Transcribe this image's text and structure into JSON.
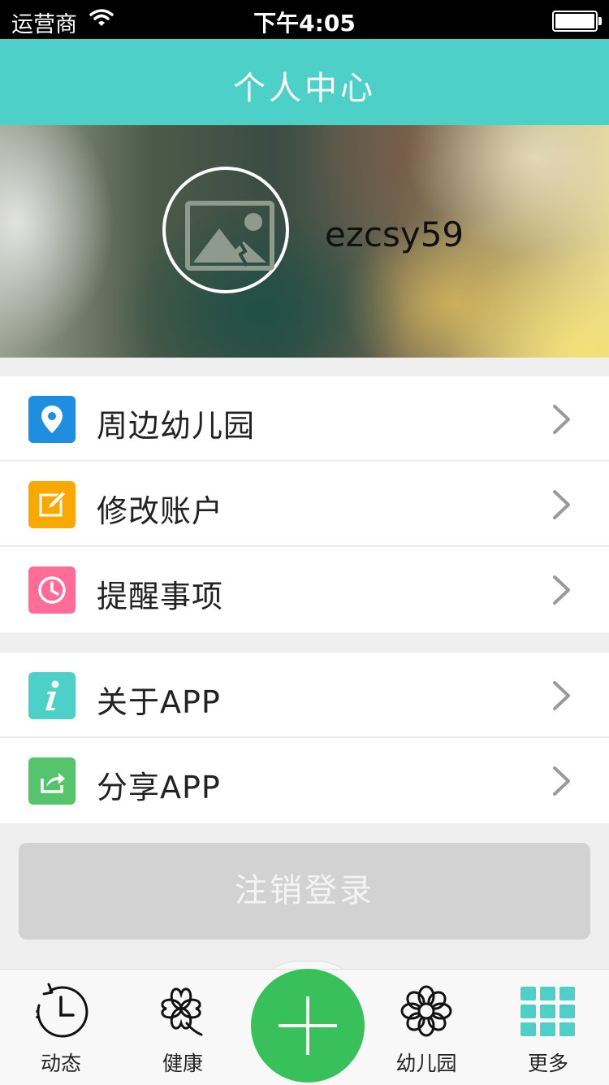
{
  "status_bar": {
    "carrier": "运营商",
    "time": "下午4:05"
  },
  "header": {
    "title": "个人中心"
  },
  "profile": {
    "username": "ezcsy59",
    "avatar_icon": "image-placeholder-icon"
  },
  "menu_group_1": [
    {
      "label": "周边幼儿园",
      "icon": "location-pin-icon",
      "color": "#1e8fe0"
    },
    {
      "label": "修改账户",
      "icon": "edit-icon",
      "color": "#f9a800"
    },
    {
      "label": "提醒事项",
      "icon": "clock-icon",
      "color": "#ff6c97"
    }
  ],
  "menu_group_2": [
    {
      "label": "关于APP",
      "icon": "info-icon",
      "color": "#4dd0c8"
    },
    {
      "label": "分享APP",
      "icon": "share-icon",
      "color": "#55c46c"
    }
  ],
  "logout": {
    "label": "注销登录"
  },
  "tab_bar": [
    {
      "label": "动态",
      "icon": "history-icon"
    },
    {
      "label": "健康",
      "icon": "clover-icon"
    },
    {
      "label": "",
      "icon": "plus-icon"
    },
    {
      "label": "幼儿园",
      "icon": "flower-icon"
    },
    {
      "label": "更多",
      "icon": "grid-icon"
    }
  ],
  "colors": {
    "accent": "#4dd0c8",
    "add_button": "#38c05a",
    "logout_bg": "#d2d2d2"
  }
}
